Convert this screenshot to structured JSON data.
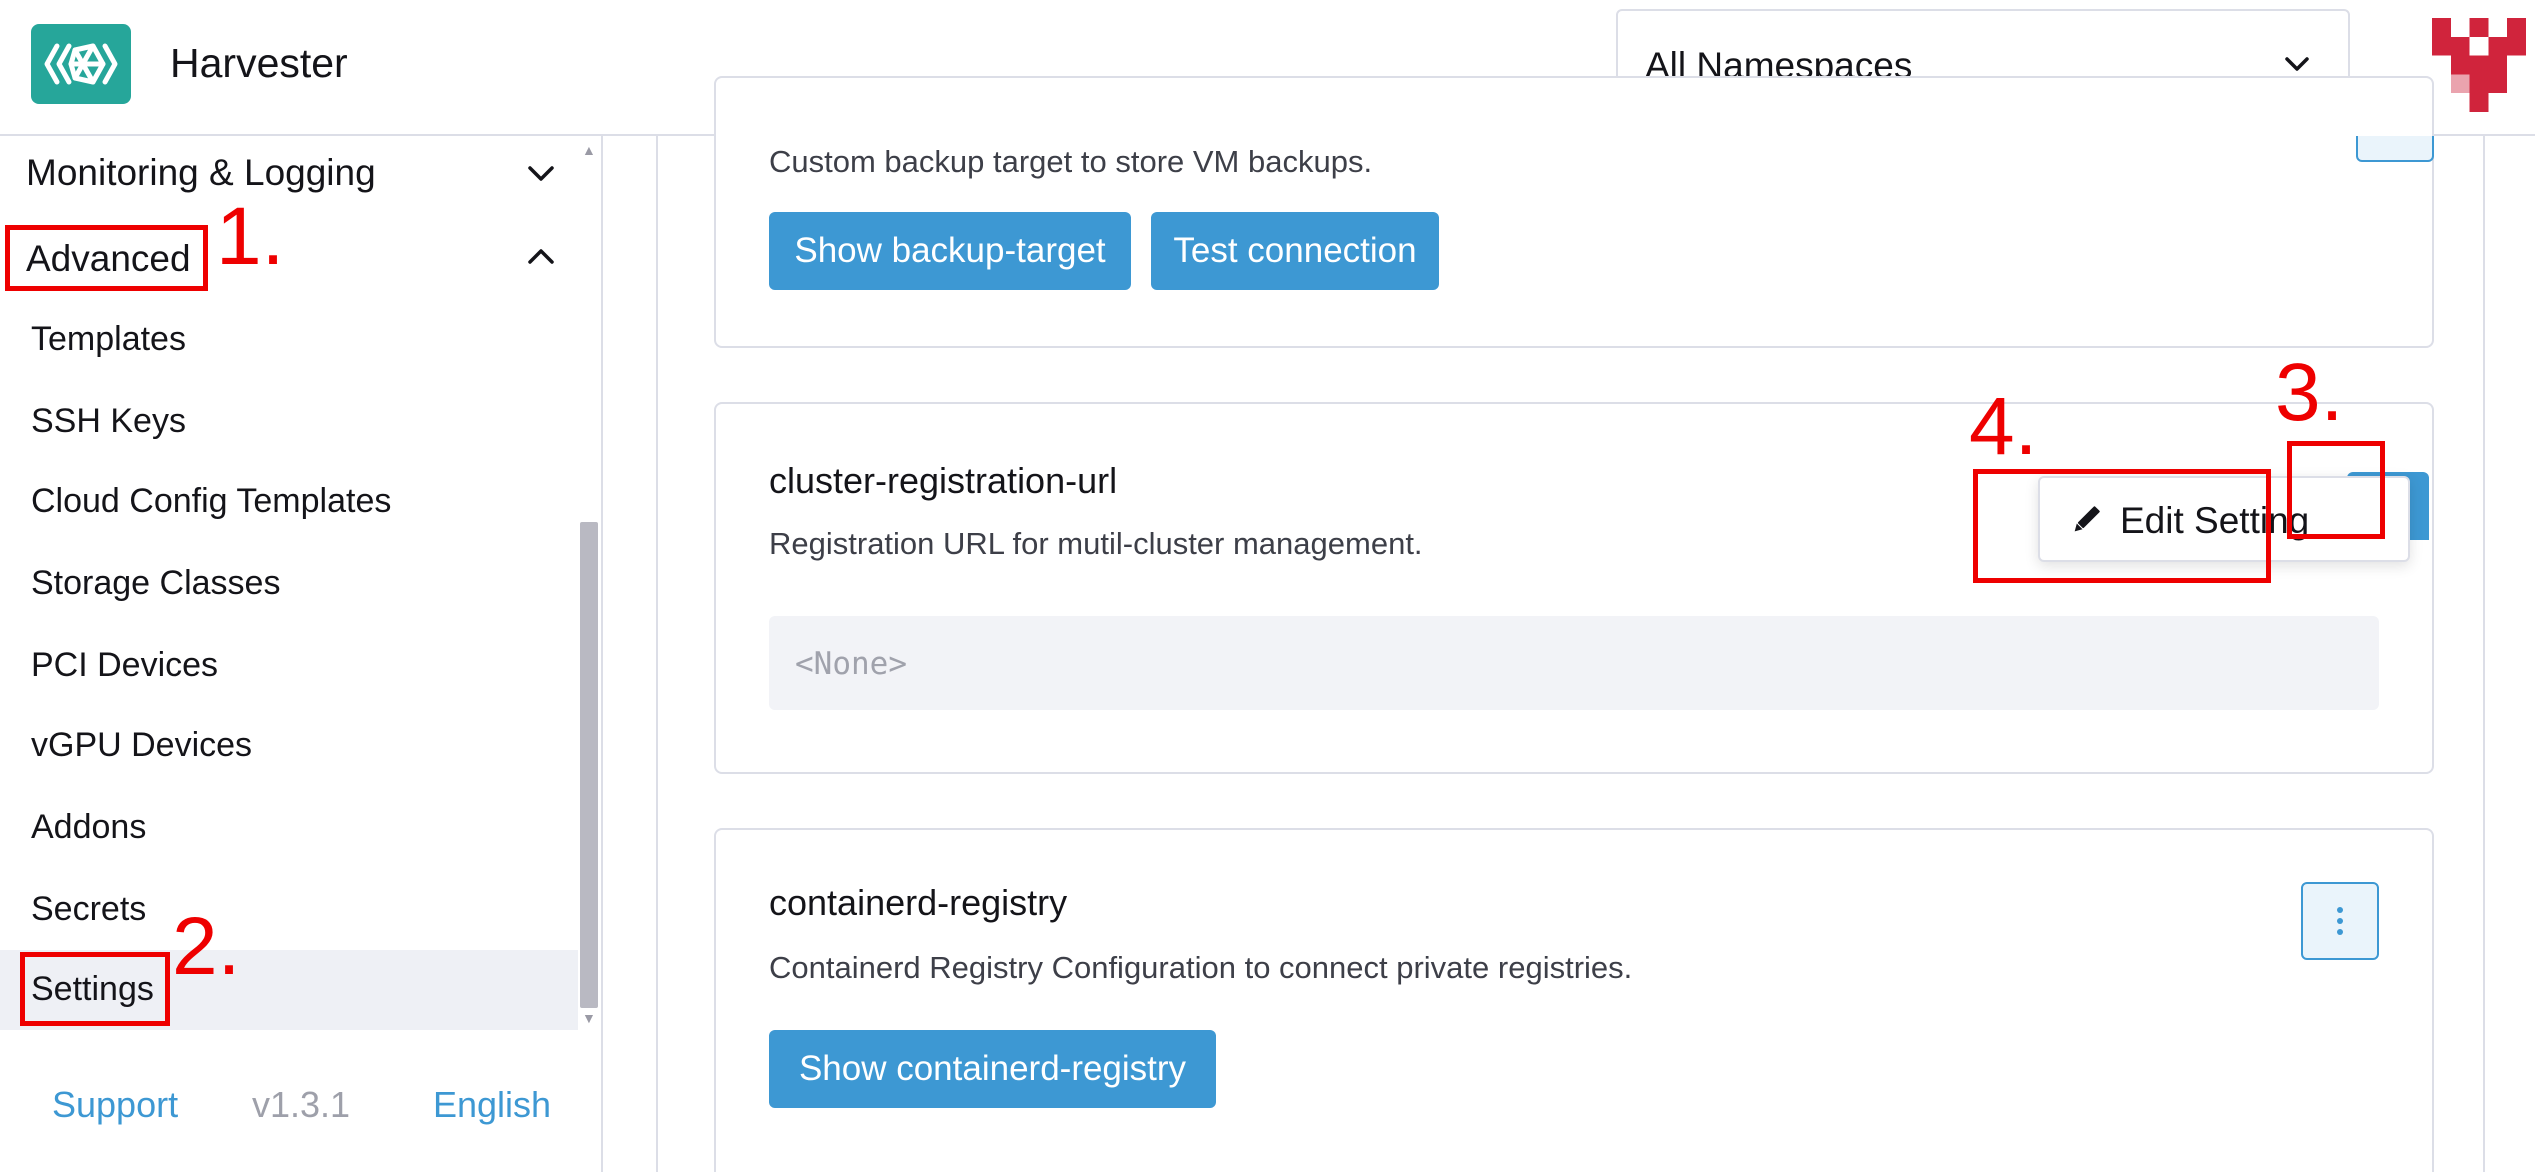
{
  "header": {
    "app_title": "Harvester",
    "namespace_select": {
      "value": "All Namespaces"
    }
  },
  "sidebar": {
    "groups": [
      {
        "label": "Monitoring & Logging",
        "expanded": false
      },
      {
        "label": "Advanced",
        "expanded": true
      }
    ],
    "items": [
      {
        "label": "Templates"
      },
      {
        "label": "SSH Keys"
      },
      {
        "label": "Cloud Config Templates"
      },
      {
        "label": "Storage Classes"
      },
      {
        "label": "PCI Devices"
      },
      {
        "label": "vGPU Devices"
      },
      {
        "label": "Addons"
      },
      {
        "label": "Secrets"
      },
      {
        "label": "Settings",
        "active": true
      }
    ],
    "footer": {
      "support": "Support",
      "version": "v1.3.1",
      "language": "English"
    }
  },
  "main": {
    "cards": [
      {
        "description": "Custom backup target to store VM backups.",
        "buttons": [
          "Show backup-target",
          "Test connection"
        ]
      },
      {
        "title": "cluster-registration-url",
        "description": "Registration URL for mutil-cluster management.",
        "value": "<None>"
      },
      {
        "title": "containerd-registry",
        "description": "Containerd Registry Configuration to connect private registries.",
        "buttons": [
          "Show containerd-registry"
        ]
      }
    ],
    "dropdown_menu": {
      "items": [
        {
          "label": "Edit Setting",
          "icon": "pencil-icon"
        }
      ]
    }
  },
  "annotations": {
    "step1": "1.",
    "step2": "2.",
    "step3": "3.",
    "step4": "4."
  },
  "colors": {
    "accent": "#3d98d3",
    "brand": "#26a69a",
    "annotation": "#ee0000"
  }
}
